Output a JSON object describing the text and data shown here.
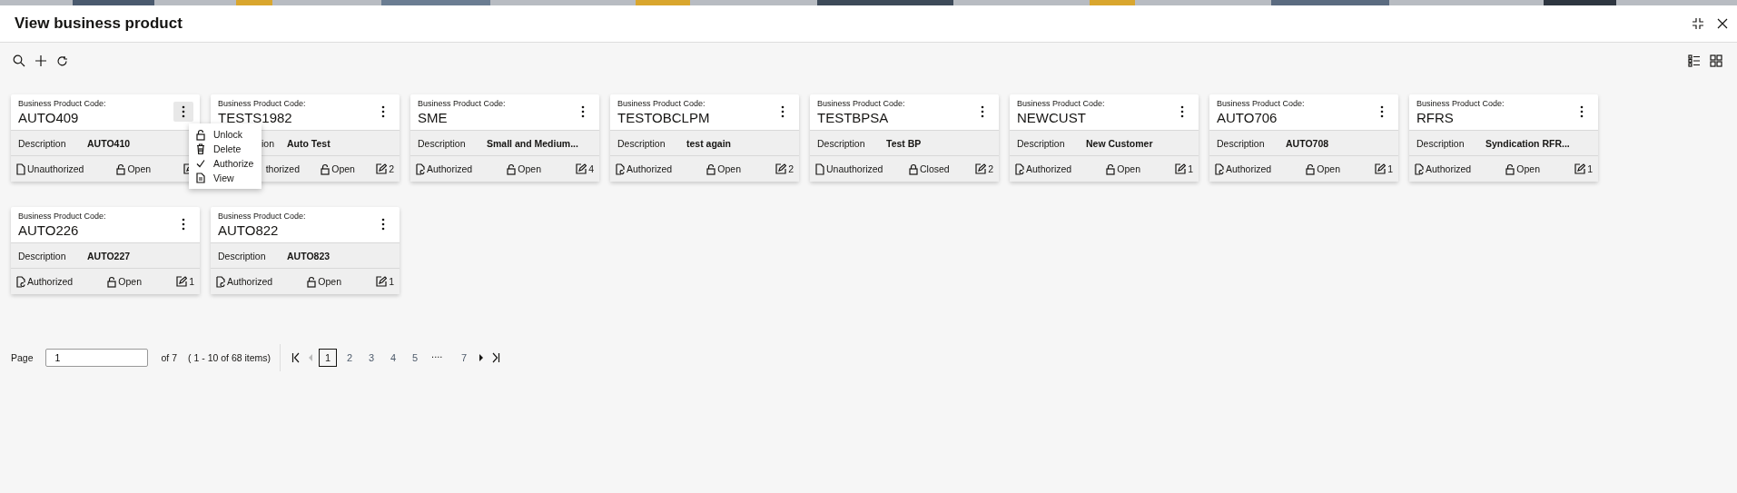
{
  "window": {
    "title": "View business product"
  },
  "cards": [
    {
      "code_label": "Business Product Code:",
      "code": "AUTO409",
      "description_label": "Description",
      "description": "AUTO410",
      "status": {
        "text": "Unauthorized",
        "authorized": false
      },
      "lock": {
        "text": "Open",
        "locked": false
      },
      "menu": [
        {
          "label": "Unlock",
          "kind": "unlock"
        },
        {
          "label": "Delete",
          "kind": "delete"
        },
        {
          "label": "Authorize",
          "kind": "authorize"
        },
        {
          "label": "View",
          "kind": "view"
        }
      ]
    },
    {
      "code_label": "Business Product Code:",
      "code": "TESTS1982",
      "description_label": "ion",
      "label_covered": true,
      "description": "Auto Test",
      "status": {
        "text": "thorized",
        "covered": true
      },
      "lock": {
        "text": "Open",
        "locked": false
      },
      "edits": "2"
    },
    {
      "code_label": "Business Product Code:",
      "code": "SME",
      "description_label": "Description",
      "description": "Small and Medium...",
      "status": {
        "text": "Authorized",
        "authorized": true
      },
      "lock": {
        "text": "Open",
        "locked": false
      },
      "edits": "4"
    },
    {
      "code_label": "Business Product Code:",
      "code": "TESTOBCLPM",
      "description_label": "Description",
      "description": "test again",
      "status": {
        "text": "Authorized",
        "authorized": true
      },
      "lock": {
        "text": "Open",
        "locked": false
      },
      "edits": "2"
    },
    {
      "code_label": "Business Product Code:",
      "code": "TESTBPSA",
      "description_label": "Description",
      "description": "Test BP",
      "status": {
        "text": "Unauthorized",
        "authorized": false
      },
      "lock": {
        "text": "Closed",
        "locked": true
      },
      "edits": "2"
    },
    {
      "code_label": "Business Product Code:",
      "code": "NEWCUST",
      "description_label": "Description",
      "description": "New Customer",
      "status": {
        "text": "Authorized",
        "authorized": true
      },
      "lock": {
        "text": "Open",
        "locked": false
      },
      "edits": "1"
    },
    {
      "code_label": "Business Product Code:",
      "code": "AUTO706",
      "description_label": "Description",
      "description": "AUTO708",
      "status": {
        "text": "Authorized",
        "authorized": true
      },
      "lock": {
        "text": "Open",
        "locked": false
      },
      "edits": "1"
    },
    {
      "code_label": "Business Product Code:",
      "code": "RFRS",
      "description_label": "Description",
      "description": "Syndication RFR...",
      "status": {
        "text": "Authorized",
        "authorized": true
      },
      "lock": {
        "text": "Open",
        "locked": false
      },
      "edits": "1"
    },
    {
      "code_label": "Business Product Code:",
      "code": "AUTO226",
      "description_label": "Description",
      "description": "AUTO227",
      "status": {
        "text": "Authorized",
        "authorized": true
      },
      "lock": {
        "text": "Open",
        "locked": false
      },
      "edits": "1"
    },
    {
      "code_label": "Business Product Code:",
      "code": "AUTO822",
      "description_label": "Description",
      "description": "AUTO823",
      "status": {
        "text": "Authorized",
        "authorized": true
      },
      "lock": {
        "text": "Open",
        "locked": false
      },
      "edits": "1"
    }
  ],
  "pagination": {
    "label": "Page",
    "page_value": "1",
    "of_pages": "of 7",
    "items_info": "( 1 - 10 of 68 items)",
    "pages": [
      {
        "label": "1",
        "selected": true
      },
      {
        "label": "2",
        "selected": false
      },
      {
        "label": "3",
        "selected": false
      },
      {
        "label": "4",
        "selected": false
      },
      {
        "label": "5",
        "selected": false
      },
      {
        "label": "....",
        "selected": false,
        "kind": "gap"
      },
      {
        "label": "7",
        "selected": false
      }
    ]
  }
}
